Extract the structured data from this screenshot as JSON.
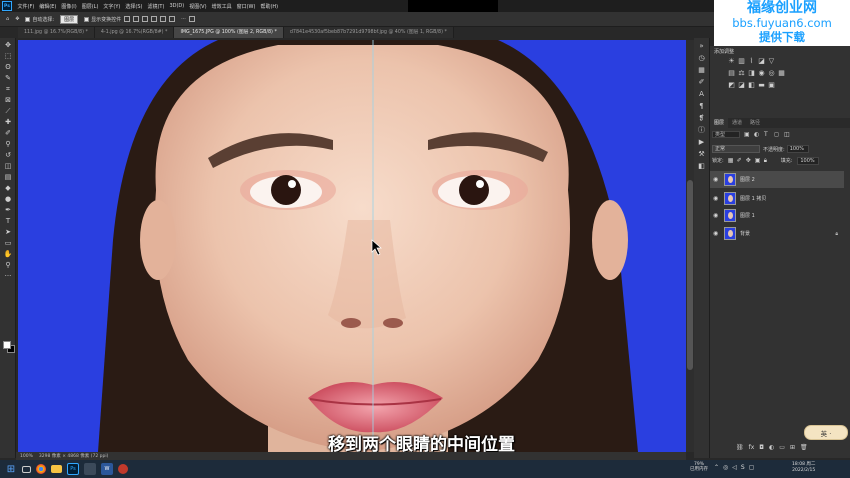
{
  "menubar": {
    "logo": "Ps",
    "items": [
      "文件(F)",
      "编辑(E)",
      "图像(I)",
      "图层(L)",
      "文字(Y)",
      "选择(S)",
      "滤镜(T)",
      "3D(D)",
      "视图(V)",
      "增效工具",
      "窗口(W)",
      "帮助(H)"
    ]
  },
  "watermark": {
    "line1": "福缘创业网",
    "line2": "bbs.fuyuan6.com",
    "line3": "提供下载"
  },
  "optionsbar": {
    "auto_select_label": "自动选择:",
    "auto_select_value": "图层",
    "show_transform_label": "显示变换控件"
  },
  "tabs": [
    {
      "label": "111.jpg @ 16.7%(RGB/8) *"
    },
    {
      "label": "4-1.jpg @ 16.7%(RGB/8#) *"
    },
    {
      "label": "IMG_1675.JPG @ 100% (图层 2, RGB/8) *"
    },
    {
      "label": "d7841e4530af5beb87b7291d9798bf.jpg @ 40% (图层 1, RGB/8) *"
    }
  ],
  "subtitle": "移到两个眼睛的中间位置",
  "statusbar": {
    "zoom": "100%",
    "doc": "3298 像素 × 4868 像素 (72 ppi)"
  },
  "right_panel": {
    "adjust_title": "添加调整",
    "layers_tabs": [
      "图层",
      "通道",
      "路径"
    ],
    "search_placeholder": "类型",
    "blend_mode": "正常",
    "opacity_label": "不透明度:",
    "opacity_value": "100%",
    "lock_label": "锁定:",
    "fill_label": "填充:",
    "fill_value": "100%",
    "layers": [
      {
        "name": "图层 2",
        "selected": true
      },
      {
        "name": "图层 1 拷贝",
        "selected": false
      },
      {
        "name": "图层 1",
        "selected": false
      },
      {
        "name": "背景",
        "selected": false,
        "locked": true
      }
    ]
  },
  "ime": "英 ·",
  "taskbar": {
    "battery_pct": "79%",
    "battery_label": "已用内存",
    "time": "18:08 周二",
    "date": "2022/2/15"
  },
  "colors": {
    "canvas_bg": "#2a3fe0",
    "ps_bg": "#323232",
    "watermark": "#1aa0ff"
  }
}
